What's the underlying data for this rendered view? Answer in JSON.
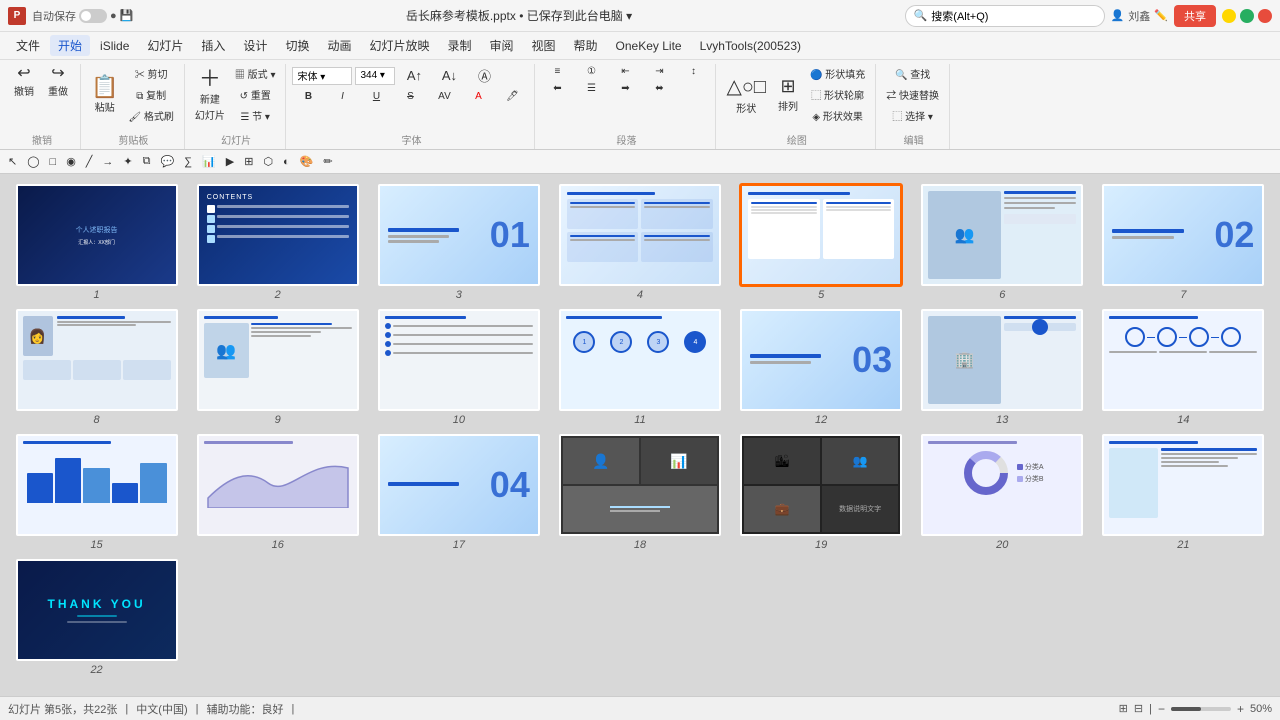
{
  "titlebar": {
    "app_icon": "P",
    "autosave_label": "自动保存",
    "filename": "岳长麻参考模板.pptx • 已保存到此台电脑 ▾",
    "search_placeholder": "搜索(Alt+Q)",
    "user_label": "刘鑫",
    "share_label": "共享"
  },
  "menubar": {
    "items": [
      "文件",
      "开始",
      "iSlide",
      "幻灯片",
      "插入",
      "设计",
      "切换",
      "动画",
      "幻灯片放映",
      "录制",
      "审阅",
      "视图",
      "帮助",
      "OneKey Lite",
      "LvyhTools(200523)"
    ]
  },
  "ribbon": {
    "groups": [
      {
        "label": "撤销",
        "items": [
          "撤销",
          "重做"
        ]
      },
      {
        "label": "剪贴板",
        "items": [
          "粘贴",
          "剪切",
          "复制",
          "格式刷"
        ]
      },
      {
        "label": "幻灯片",
        "items": [
          "新建幻灯片",
          "版式",
          "重置"
        ]
      },
      {
        "label": "字体",
        "items": [
          "字体",
          "字号",
          "加粗",
          "斜体",
          "下划线",
          "删除线",
          "文字间距",
          "字体颜色",
          "高亮颜色"
        ]
      },
      {
        "label": "段落",
        "items": [
          "项目符号",
          "编号",
          "对齐",
          "行距"
        ]
      },
      {
        "label": "绘图",
        "items": [
          "形状",
          "排列",
          "形状填充",
          "形状轮廓",
          "形状效果"
        ]
      },
      {
        "label": "编辑",
        "items": [
          "查找",
          "替换",
          "选择"
        ]
      }
    ]
  },
  "slides": [
    {
      "num": "1",
      "type": "title",
      "label": "个人述职报告",
      "sublabel": "汇报人：XX部门",
      "selected": false
    },
    {
      "num": "2",
      "type": "contents",
      "label": "CONTENTS",
      "selected": false
    },
    {
      "num": "3",
      "type": "section",
      "big": "01",
      "selected": false
    },
    {
      "num": "4",
      "type": "content",
      "selected": false
    },
    {
      "num": "5",
      "type": "content2",
      "selected": true
    },
    {
      "num": "6",
      "type": "photo",
      "selected": false
    },
    {
      "num": "7",
      "type": "section2",
      "big": "02",
      "selected": false
    },
    {
      "num": "8",
      "type": "person",
      "selected": false
    },
    {
      "num": "9",
      "type": "team",
      "selected": false
    },
    {
      "num": "10",
      "type": "list",
      "selected": false
    },
    {
      "num": "11",
      "type": "circles",
      "selected": false
    },
    {
      "num": "12",
      "type": "section3",
      "big": "03",
      "selected": false
    },
    {
      "num": "13",
      "type": "photo2",
      "selected": false
    },
    {
      "num": "14",
      "type": "diagram",
      "selected": false
    },
    {
      "num": "15",
      "type": "chart",
      "selected": false
    },
    {
      "num": "16",
      "type": "area",
      "selected": false
    },
    {
      "num": "17",
      "type": "section4",
      "big": "04",
      "selected": false
    },
    {
      "num": "18",
      "type": "collage",
      "selected": false
    },
    {
      "num": "19",
      "type": "dark-collage",
      "selected": false
    },
    {
      "num": "20",
      "type": "donut",
      "selected": false
    },
    {
      "num": "21",
      "type": "table2",
      "selected": false
    },
    {
      "num": "22",
      "type": "thankyou",
      "label": "THANK YOU",
      "selected": false
    }
  ],
  "statusbar": {
    "slide_info": "幻灯片 第5张，共22张",
    "lang": "中文(中国)",
    "accessibility": "辅助功能：良好",
    "zoom": "50%",
    "view_normal": "普通",
    "view_slide_sorter": "幻灯片浏览"
  }
}
